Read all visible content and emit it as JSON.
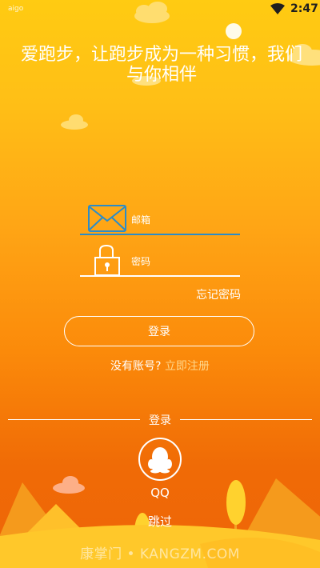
{
  "status_bar": {
    "carrier": "aigo",
    "time": "2:47"
  },
  "slogan": "爱跑步，让跑步成为一种习惯，我们与你相伴",
  "login_form": {
    "email_label": "邮箱",
    "password_label": "密码",
    "forgot_password": "忘记密码",
    "login_button": "登录"
  },
  "register": {
    "prompt": "没有账号?",
    "link": "立即注册"
  },
  "third_party": {
    "divider_label": "登录",
    "qq_label": "QQ"
  },
  "skip": "跳过",
  "watermark": "康掌门 • KANGZM.COM",
  "colors": {
    "accent_blue": "#2a8cc9",
    "register_link": "#ffd68a",
    "bg_top": "#ffcb12",
    "bg_bottom": "#ee6408"
  },
  "icons": [
    "wifi-icon",
    "mail-icon",
    "lock-icon",
    "qq-penguin-icon"
  ]
}
